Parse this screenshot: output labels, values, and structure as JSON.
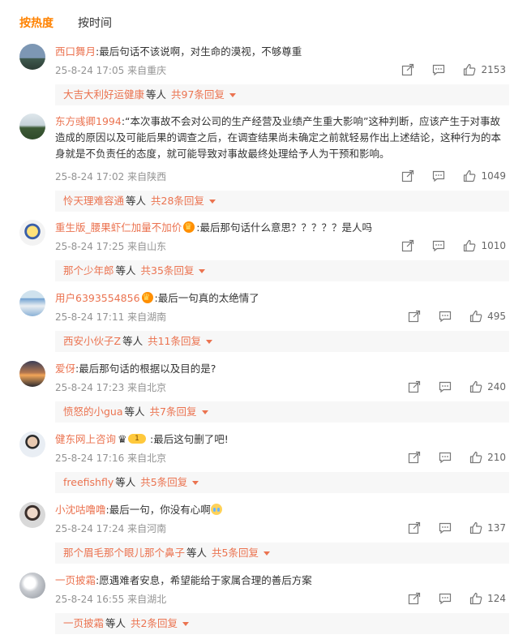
{
  "tabs": {
    "hot": "按热度",
    "time": "按时间"
  },
  "labels": {
    "etc": "等人"
  },
  "colors": {
    "accent": "#ff8200",
    "username": "#eb7350",
    "meta": "#939393",
    "reply_bg": "#f7f7f7"
  },
  "comments": [
    {
      "user": "西口舞月",
      "text": ":最后句话不该说啊，对生命的漠视，不够尊重",
      "date": "25-8-24 17:05",
      "loc": "来自重庆",
      "likes": "2153",
      "reply_user": "大吉大利好运健康",
      "reply_count": "共97条回复"
    },
    {
      "user": "东方彧卿1994",
      "text": ":“本次事故不会对公司的生产经营及业绩产生重大影响”这种判断，应该产生于对事故造成的原因以及可能后果的调查之后，在调查结果尚未确定之前就轻易作出上述结论，这种行为的本身就是不负责任的态度，就可能导致对事故最终处理给予人为干预和影响。",
      "date": "25-8-24 17:02",
      "loc": "来自陕西",
      "likes": "1049",
      "reply_user": "怜天理难容通",
      "reply_count": "共28条回复"
    },
    {
      "user": "重生版_腰果虾仁加量不加价",
      "text": ":最后那句话什么意思？？？？？是人吗",
      "date": "25-8-24 17:25",
      "loc": "来自山东",
      "likes": "1010",
      "reply_user": "那个少年郎",
      "reply_count": "共35条回复"
    },
    {
      "user": "用户6393554856",
      "text": ":最后一句真的太绝情了",
      "date": "25-8-24 17:11",
      "loc": "来自湖南",
      "likes": "495",
      "reply_user": "西安小伙子Z",
      "reply_count": "共11条回复"
    },
    {
      "user": "爱伢",
      "text": ":最后那句话的根据以及目的是?",
      "date": "25-8-24 17:23",
      "loc": "来自北京",
      "likes": "240",
      "reply_user": "愤怒的小gua",
      "reply_count": "共7条回复"
    },
    {
      "user": "健东网上咨询",
      "text": ":最后这句删了吧!",
      "date": "25-8-24 17:16",
      "loc": "来自北京",
      "likes": "210",
      "reply_user": "freefishfly",
      "reply_count": "共5条回复",
      "level": "1"
    },
    {
      "user": "小沈咕噜噜",
      "text": ":最后一句，你没有心啊",
      "date": "25-8-24 17:24",
      "loc": "来自河南",
      "likes": "137",
      "reply_user": "那个眉毛那个眼儿那个鼻子",
      "reply_count": "共5条回复"
    },
    {
      "user": "一页披霜",
      "text": ":愿遇难者安息，希望能给于家属合理的善后方案",
      "date": "25-8-24 16:55",
      "loc": "来自湖北",
      "likes": "124",
      "reply_user": "一页披霜",
      "reply_count": "共2条回复"
    }
  ]
}
